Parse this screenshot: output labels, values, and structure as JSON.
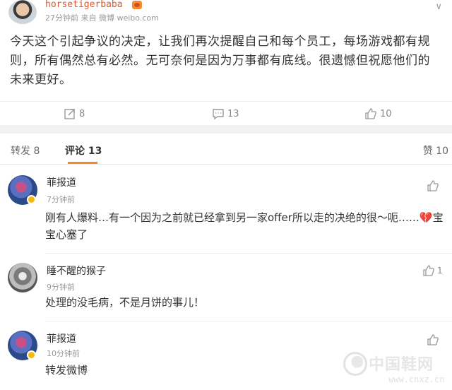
{
  "post": {
    "username": "horsetigerbaba",
    "meta": "27分钟前 来自 微博 weibo.com",
    "text": "今天这个引起争议的决定，让我们再次提醒自己和每个员工，每场游戏都有规则，所有偶然总有必然。无可奈何是因为万事都有底线。很遗憾但祝愿他们的未来更好。",
    "menu_glyph": "∨"
  },
  "actions": {
    "repost_count": "8",
    "comment_count": "13",
    "like_count": "10"
  },
  "tabs": {
    "repost": "转发 8",
    "comments": "评论 13",
    "likes": "赞 10"
  },
  "comments": [
    {
      "name": "菲报道",
      "time": "7分钟前",
      "text_main": "刚有人爆料…有一个因为之前就已经拿到另一家offer所以走的决绝的很～呃……",
      "emoji": "💔",
      "text_tail": "宝宝心塞了",
      "likes": ""
    },
    {
      "name": "睡不醒的猴子",
      "time": "9分钟前",
      "text": "处理的没毛病，不是月饼的事儿！",
      "likes": "1"
    },
    {
      "name": "菲报道",
      "time": "10分钟前",
      "text": "转发微博",
      "likes": ""
    }
  ],
  "watermark": {
    "name": "中国鞋网",
    "url": "www.cnxz.cn"
  },
  "colors": {
    "username": "#e0562c",
    "tab_accent": "#f08a24",
    "vip": "#f5b80e"
  },
  "icons": [
    "avatar",
    "vip-badge",
    "chevron-down-icon",
    "repost-icon",
    "comment-icon",
    "like-icon",
    "heart-broken-icon"
  ]
}
